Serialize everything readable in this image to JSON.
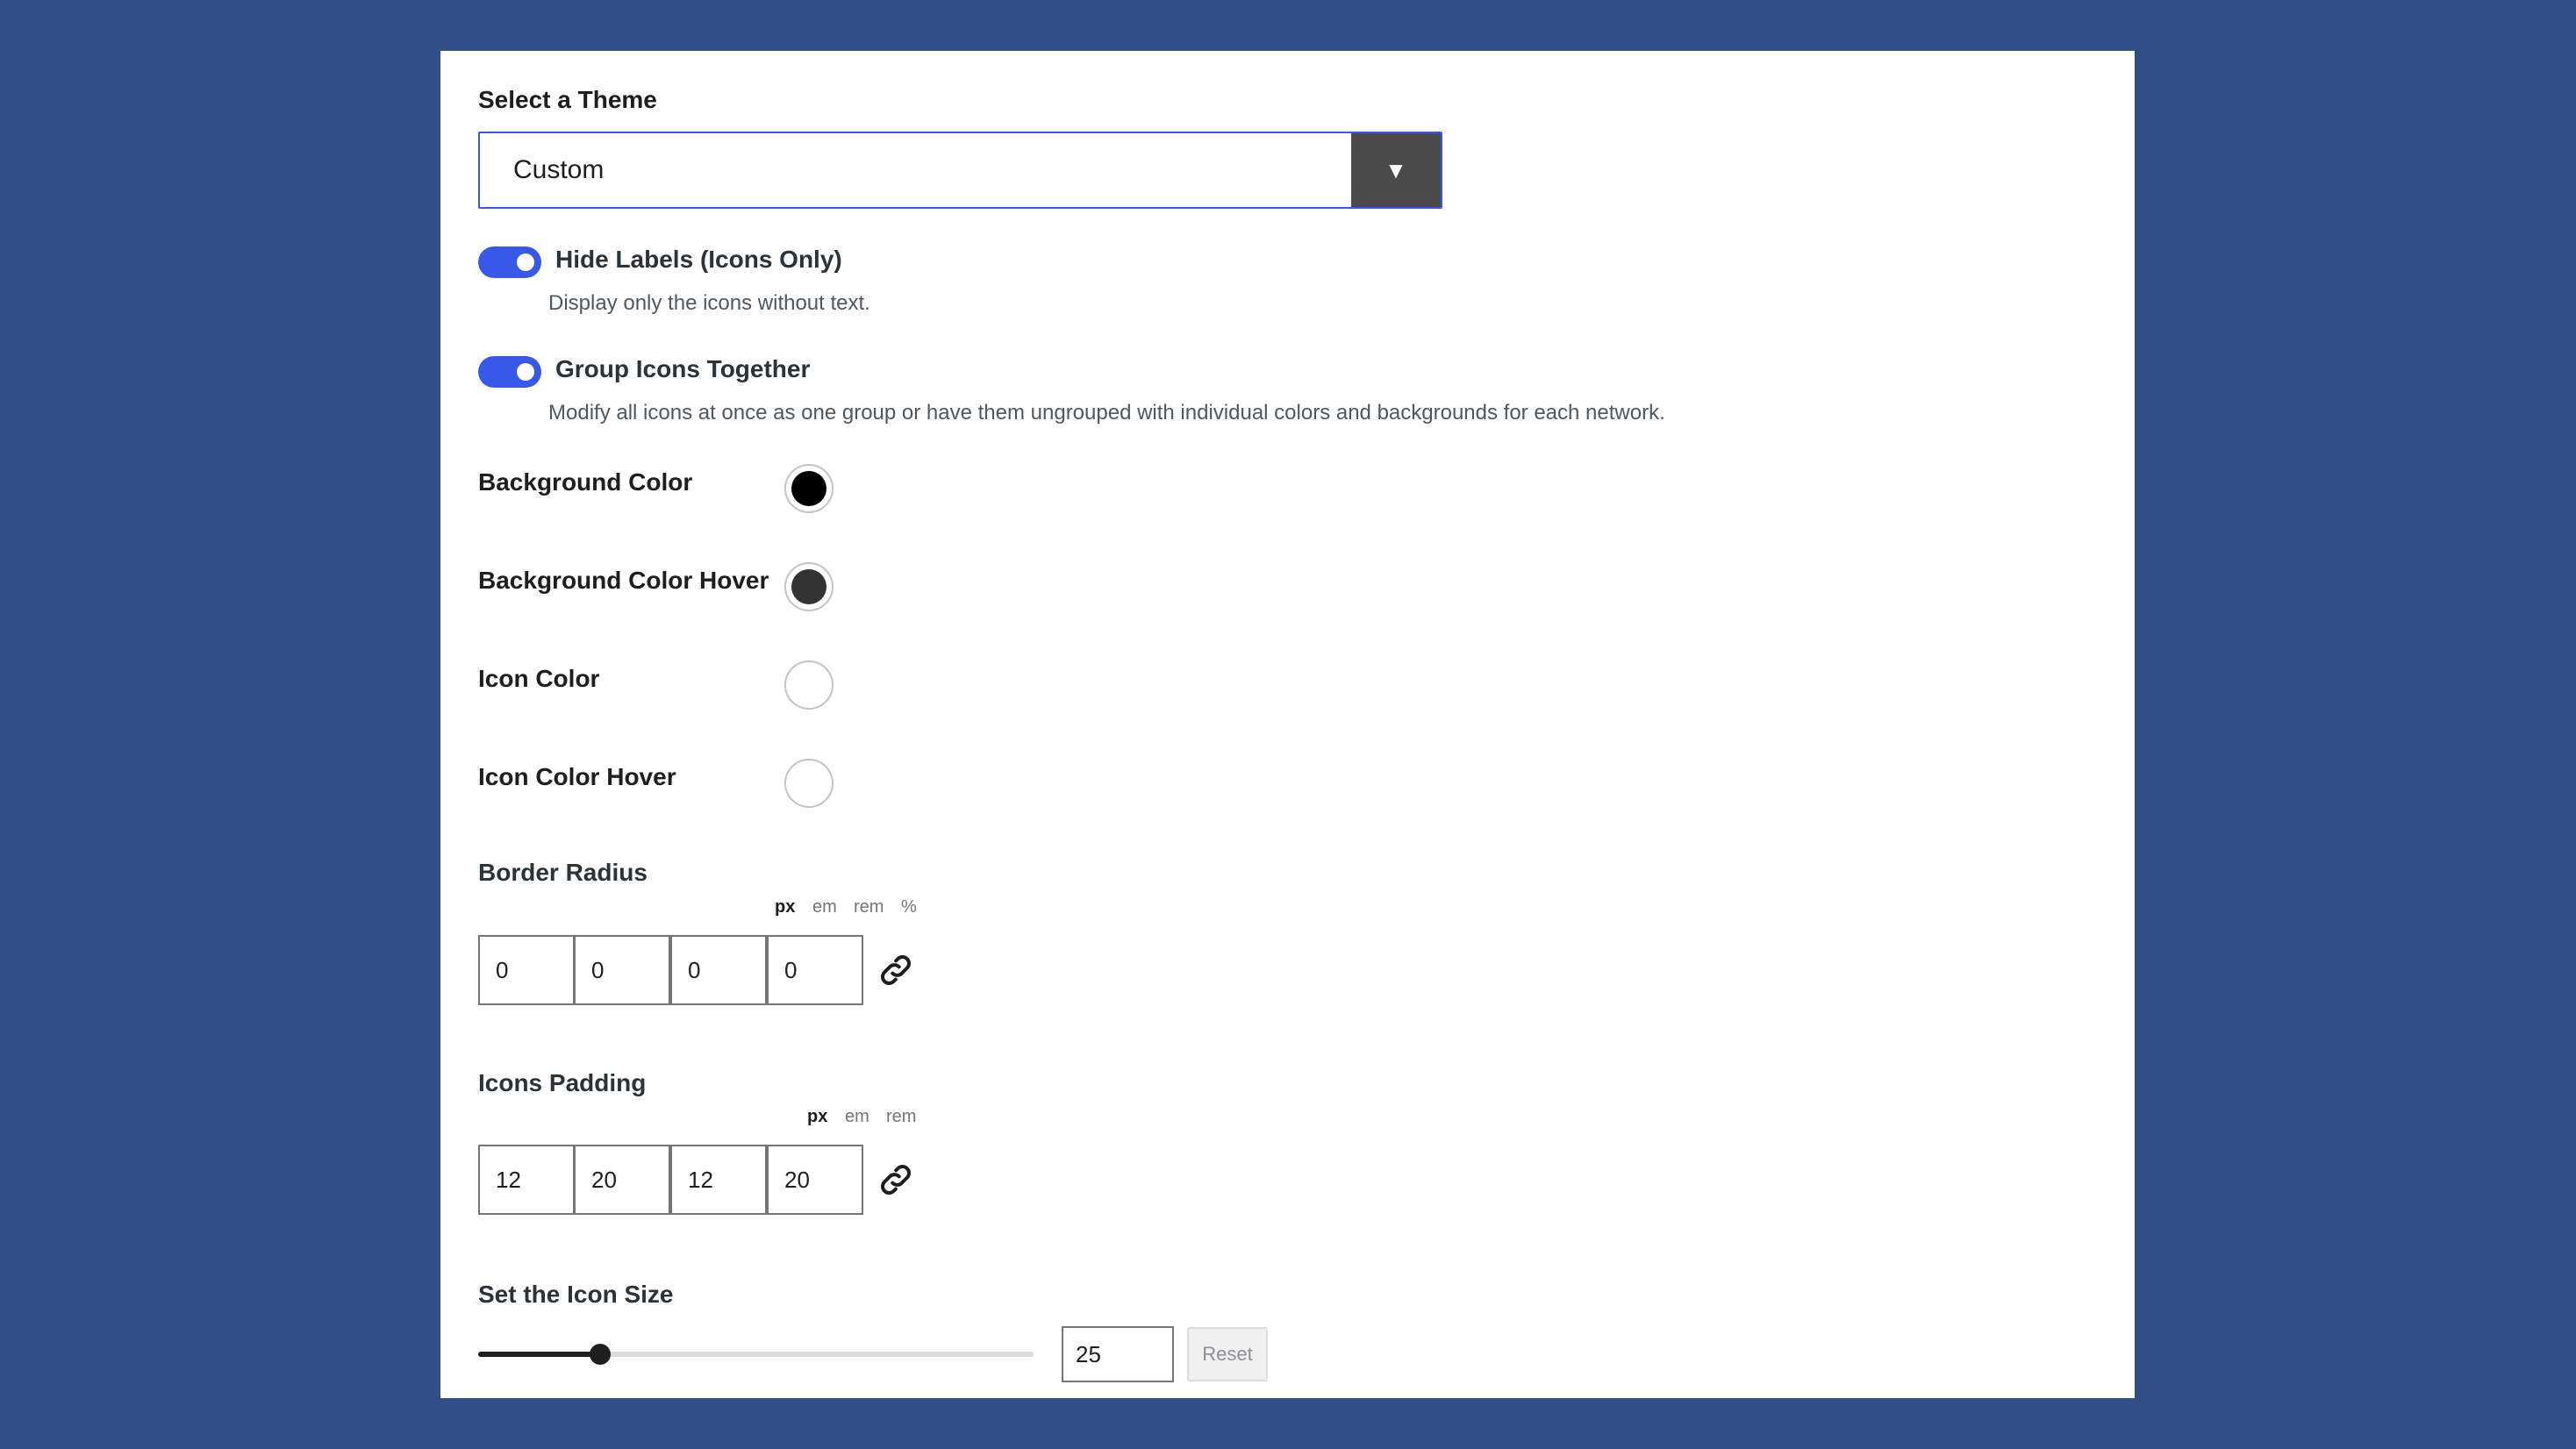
{
  "theme": {
    "label": "Select a Theme",
    "selected": "Custom",
    "arrow": "▼"
  },
  "toggles": [
    {
      "label": "Hide Labels (Icons Only)",
      "help": "Display only the icons without text.",
      "on": true
    },
    {
      "label": "Group Icons Together",
      "help": "Modify all icons at once as one group or have them ungrouped with individual colors and backgrounds for each network.",
      "on": true
    }
  ],
  "colors": [
    {
      "label": "Background Color",
      "value": "#000000"
    },
    {
      "label": "Background Color Hover",
      "value": "#333333"
    },
    {
      "label": "Icon Color",
      "value": "#ffffff"
    },
    {
      "label": "Icon Color Hover",
      "value": "#ffffff"
    }
  ],
  "border_radius": {
    "label": "Border Radius",
    "units": [
      "px",
      "em",
      "rem",
      "%"
    ],
    "active_unit": "px",
    "values": [
      "0",
      "0",
      "0",
      "0"
    ]
  },
  "icons_padding": {
    "label": "Icons Padding",
    "units": [
      "px",
      "em",
      "rem"
    ],
    "active_unit": "px",
    "values": [
      "12",
      "20",
      "12",
      "20"
    ]
  },
  "icon_size": {
    "label": "Set the Icon Size",
    "value": "25",
    "slider_fraction": 0.22,
    "reset_label": "Reset"
  },
  "accent_color": "#3858e9",
  "icons": {
    "select_arrow": "chevron-down-icon",
    "link": "link-icon"
  }
}
